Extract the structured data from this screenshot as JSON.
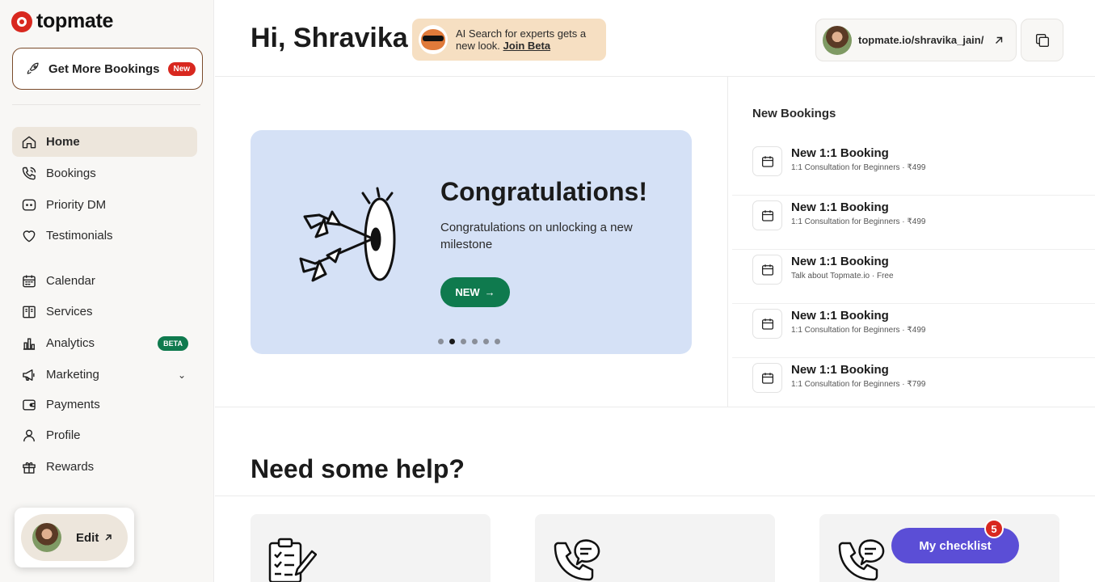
{
  "brand": {
    "name": "topmate"
  },
  "sidebar": {
    "cta": {
      "label": "Get More Bookings",
      "badge": "New"
    },
    "items": [
      {
        "label": "Home",
        "icon": "home-icon",
        "active": true
      },
      {
        "label": "Bookings",
        "icon": "phone-icon"
      },
      {
        "label": "Priority DM",
        "icon": "chat-icon"
      },
      {
        "label": "Testimonials",
        "icon": "heart-icon"
      },
      {
        "label": "Calendar",
        "icon": "calendar-icon"
      },
      {
        "label": "Services",
        "icon": "book-icon"
      },
      {
        "label": "Analytics",
        "icon": "bar-chart-icon",
        "badge": "BETA"
      },
      {
        "label": "Marketing",
        "icon": "megaphone-icon"
      },
      {
        "label": "Payments",
        "icon": "wallet-icon"
      },
      {
        "label": "Profile",
        "icon": "user-icon"
      },
      {
        "label": "Rewards",
        "icon": "gift-icon"
      }
    ],
    "edit_label": "Edit"
  },
  "header": {
    "greeting": "Hi, Shravika",
    "banner_text": "AI Search for experts gets a new look.",
    "banner_link": "Join Beta",
    "profile_url": "topmate.io/shravika_jain/"
  },
  "carousel": {
    "title": "Congratulations!",
    "description": "Congratulations on unlocking a new milestone",
    "button_label": "NEW",
    "total_slides": 6,
    "active_slide": 2
  },
  "bookings": {
    "title": "New Bookings",
    "items": [
      {
        "title": "New 1:1 Booking",
        "subtitle": "1:1 Consultation for Beginners · ₹499"
      },
      {
        "title": "New 1:1 Booking",
        "subtitle": "1:1 Consultation for Beginners · ₹499"
      },
      {
        "title": "New 1:1 Booking",
        "subtitle": "Talk about Topmate.io · Free"
      },
      {
        "title": "New 1:1 Booking",
        "subtitle": "1:1 Consultation for Beginners · ₹499"
      },
      {
        "title": "New 1:1 Booking",
        "subtitle": "1:1 Consultation for Beginners · ₹799"
      }
    ]
  },
  "help": {
    "title": "Need some help?",
    "cards": [
      {
        "icon": "checklist-icon"
      },
      {
        "icon": "phone-chat-icon"
      },
      {
        "icon": "phone-chat-icon"
      }
    ]
  },
  "checklist": {
    "label": "My checklist",
    "count": "5"
  },
  "colors": {
    "brand_red": "#d8281f",
    "accent_green": "#0f7a4e",
    "checklist_purple": "#5b4ed6",
    "banner_beige": "#f6dfc2",
    "carousel_blue": "#d5e1f6"
  }
}
